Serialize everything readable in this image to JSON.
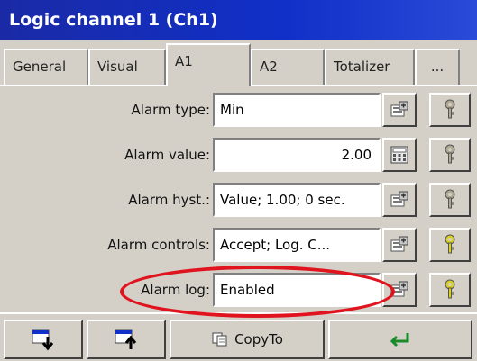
{
  "window": {
    "title": "Logic channel 1 (Ch1)"
  },
  "tabs": [
    {
      "label": "General"
    },
    {
      "label": "Visual"
    },
    {
      "label": "A1",
      "active": true
    },
    {
      "label": "A2"
    },
    {
      "label": "Totalizer"
    },
    {
      "label": "..."
    }
  ],
  "rows": [
    {
      "label": "Alarm type:",
      "value": "Min",
      "edit_icon": "list-edit-icon"
    },
    {
      "label": "Alarm value:",
      "value": "2.00",
      "edit_icon": "keypad-icon"
    },
    {
      "label": "Alarm hyst.:",
      "value": "Value; 1.00; 0 sec.",
      "edit_icon": "list-edit-icon"
    },
    {
      "label": "Alarm controls:",
      "value": "Accept; Log. C...",
      "edit_icon": "list-edit-icon"
    },
    {
      "label": "Alarm log:",
      "value": "Enabled",
      "edit_icon": "list-edit-icon"
    }
  ],
  "toolbar": {
    "copyto_label": "CopyTo"
  },
  "colors": {
    "title_bar": "#1030c8",
    "highlight": "#e0141e",
    "help_active": "#d8d020",
    "help_inactive": "#b0a890"
  }
}
